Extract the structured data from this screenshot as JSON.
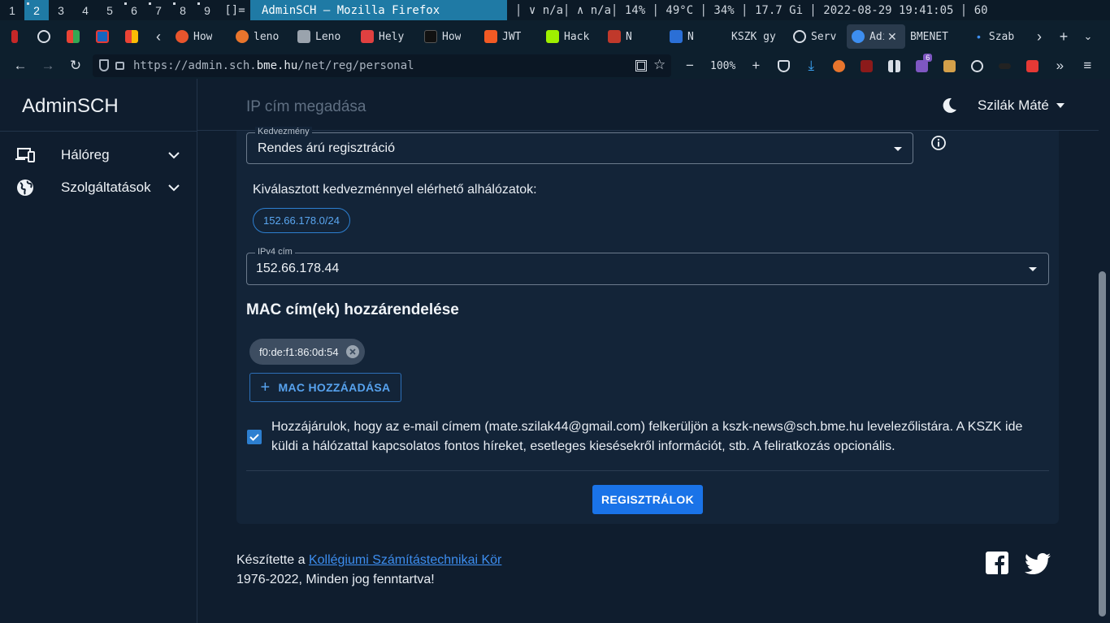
{
  "system_bar": {
    "workspaces": [
      "1",
      "2",
      "3",
      "4",
      "5",
      "6",
      "7",
      "8",
      "9"
    ],
    "active_workspace": "2",
    "layout_symbol": "[]=",
    "window_title": "AdminSCH — Mozilla Firefox",
    "status": "│ ∨ n/a│ ∧ n/a│ 14% │ 49°C │ 34% │ 17.7 Gi │ 2022-08-29 19:41:05 │ 60"
  },
  "browser": {
    "tabs": [
      {
        "label": "How",
        "color": "#e8552d"
      },
      {
        "label": "leno",
        "color": "#e8752d"
      },
      {
        "label": "Leno",
        "color": "#9aa3ad"
      },
      {
        "label": "Hely",
        "color": "#e04040"
      },
      {
        "label": "How",
        "color": "#111111"
      },
      {
        "label": "JWT",
        "color": "#f25a24"
      },
      {
        "label": "Hack",
        "color": "#9fef00"
      },
      {
        "label": "N",
        "color": "#c0392b"
      },
      {
        "label": "N",
        "color": "#2b6fd6"
      },
      {
        "label": "KSZK gy",
        "color": ""
      },
      {
        "label": "Serv",
        "color": "#d8dee6"
      },
      {
        "label": "Adı",
        "color": "#3d8ef0"
      },
      {
        "label": "BMENET",
        "color": ""
      },
      {
        "label": "Szab",
        "color": "#3d8ef0"
      }
    ],
    "url_prefix": "https://admin.sch.",
    "url_domain": "bme.hu",
    "url_path": "/net/reg/personal",
    "zoom": "100%",
    "ext_badge": "6"
  },
  "app": {
    "brand": "AdminSCH",
    "sidebar": [
      {
        "label": "Hálóreg",
        "icon": "devices-icon"
      },
      {
        "label": "Szolgáltatások",
        "icon": "globe-icon"
      }
    ],
    "page_title": "IP cím megadása",
    "user_name": "Szilák Máté"
  },
  "form": {
    "discount_label": "Kedvezmény",
    "discount_value": "Rendes árú regisztráció",
    "subnets_label": "Kiválasztott kedvezménnyel elérhető alhálózatok:",
    "subnets": [
      "152.66.178.0/24"
    ],
    "ipv4_label": "IPv4 cím",
    "ipv4_value": "152.66.178.44",
    "mac_section_title": "MAC cím(ek) hozzárendelése",
    "mac_addresses": [
      "f0:de:f1:86:0d:54"
    ],
    "add_mac_label": "MAC HOZZÁADÁSA",
    "consent_checked": true,
    "consent_text": "Hozzájárulok, hogy az e-mail címem (mate.szilak44@gmail.com) felkerüljön a kszk-news@sch.bme.hu levelezőlistára. A KSZK ide küldi a hálózattal kapcsolatos fontos híreket, esetleges kiesésekről információt, stb. A feliratkozás opcionális.",
    "register_label": "REGISZTRÁLOK"
  },
  "footer": {
    "made_by_prefix": "Készítette a ",
    "made_by_link": "Kollégiumi Számítástechnikai Kör",
    "copyright": "1976-2022, Minden jog fenntartva!"
  },
  "colors": {
    "accent": "#1a73e8",
    "link": "#3d8ef0",
    "background": "#0f1d2e",
    "card": "#132438"
  }
}
